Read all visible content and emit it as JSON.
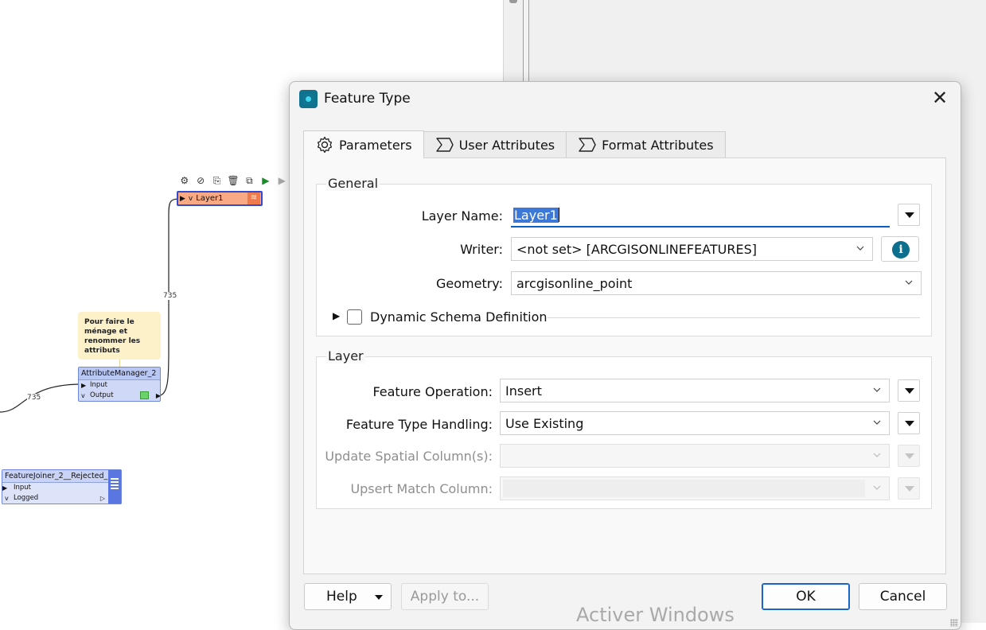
{
  "canvas": {
    "toolbar_icons": [
      "gear-icon",
      "disable-icon",
      "copy-icon",
      "delete-icon",
      "inspect-icon",
      "run-icon",
      "run-disabled-icon"
    ],
    "layer1": {
      "label": "Layer1",
      "expand": "v"
    },
    "note": {
      "text": "Pour faire le ménage et renommer les attributs"
    },
    "attribute_manager": {
      "title": "AttributeManager_2",
      "input_port": "Input",
      "output_port": "Output"
    },
    "feature_joiner": {
      "title": "FeatureJoiner_2__Rejected_",
      "input_port": "Input",
      "logged_port": "Logged"
    },
    "connections": {
      "count_left": "735",
      "count_vertical": "735"
    }
  },
  "dialog": {
    "title": "Feature Type",
    "tabs": [
      {
        "label": "Parameters",
        "icon": "gear-icon",
        "active": true
      },
      {
        "label": "User Attributes",
        "icon": "sigma-icon",
        "active": false
      },
      {
        "label": "Format Attributes",
        "icon": "sigma-icon",
        "active": false
      }
    ],
    "general": {
      "group_title": "General",
      "layer_name_label": "Layer Name:",
      "layer_name_value": "Layer1",
      "writer_label": "Writer:",
      "writer_value": "<not set> [ARCGISONLINEFEATURES]",
      "geometry_label": "Geometry:",
      "geometry_value": "arcgisonline_point",
      "dynamic_schema_label": "Dynamic Schema Definition",
      "dynamic_schema_checked": false
    },
    "layer": {
      "group_title": "Layer",
      "feature_operation_label": "Feature Operation:",
      "feature_operation_value": "Insert",
      "feature_type_handling_label": "Feature Type Handling:",
      "feature_type_handling_value": "Use Existing",
      "update_spatial_label": "Update Spatial Column(s):",
      "update_spatial_value": "",
      "upsert_match_label": "Upsert Match Column:",
      "upsert_match_value": ""
    },
    "buttons": {
      "help": "Help",
      "apply_to": "Apply to...",
      "ok": "OK",
      "cancel": "Cancel"
    },
    "watermark": "Activer Windows"
  }
}
